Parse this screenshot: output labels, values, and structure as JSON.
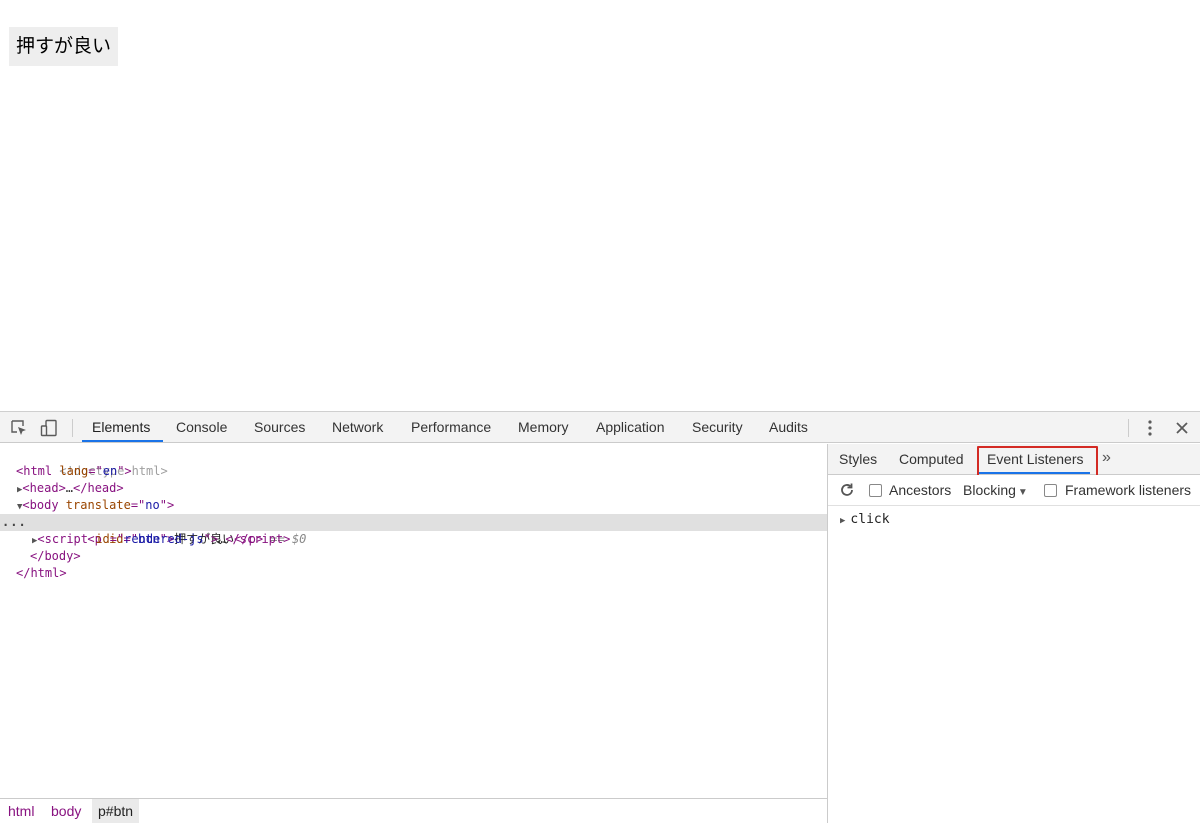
{
  "page": {
    "button_text": "押すが良い"
  },
  "devtools": {
    "main_tabs": [
      "Elements",
      "Console",
      "Sources",
      "Network",
      "Performance",
      "Memory",
      "Application",
      "Security",
      "Audits"
    ],
    "active_main_tab": "Elements",
    "icons": {
      "inspect": "inspect-element-icon",
      "device": "device-toolbar-icon",
      "menu": "more-vertical-icon",
      "close": "close-icon"
    },
    "dom": {
      "doctype": "<!doctype html>",
      "html_tag": "html",
      "html_lang_attr": "lang",
      "html_lang_value": "en",
      "head_tag": "head",
      "collapsed_ellipsis": "…",
      "body_tag": "body",
      "body_attr": "translate",
      "body_attr_value": "no",
      "p_tag": "p",
      "p_attr": "id",
      "p_attr_value": "btn",
      "p_text": "押すが良い",
      "selected_marker": "== $0",
      "script_tag": "script",
      "script_attr": "id",
      "script_attr_value": "rendered-js",
      "gutter_dots": "..."
    },
    "breadcrumb": [
      "html",
      "body",
      "p#btn"
    ],
    "side_tabs": [
      "Styles",
      "Computed",
      "Event Listeners"
    ],
    "active_side_tab": "Event Listeners",
    "more_tabs": "»",
    "listener_toolbar": {
      "ancestors_label": "Ancestors",
      "blocking_label": "Blocking",
      "framework_label": "Framework listeners"
    },
    "listeners": [
      "click"
    ],
    "colors": {
      "accent": "#1a73e8",
      "highlight": "#d32a24",
      "tag": "#881280",
      "attr": "#994500",
      "value": "#1a1aa6"
    }
  }
}
